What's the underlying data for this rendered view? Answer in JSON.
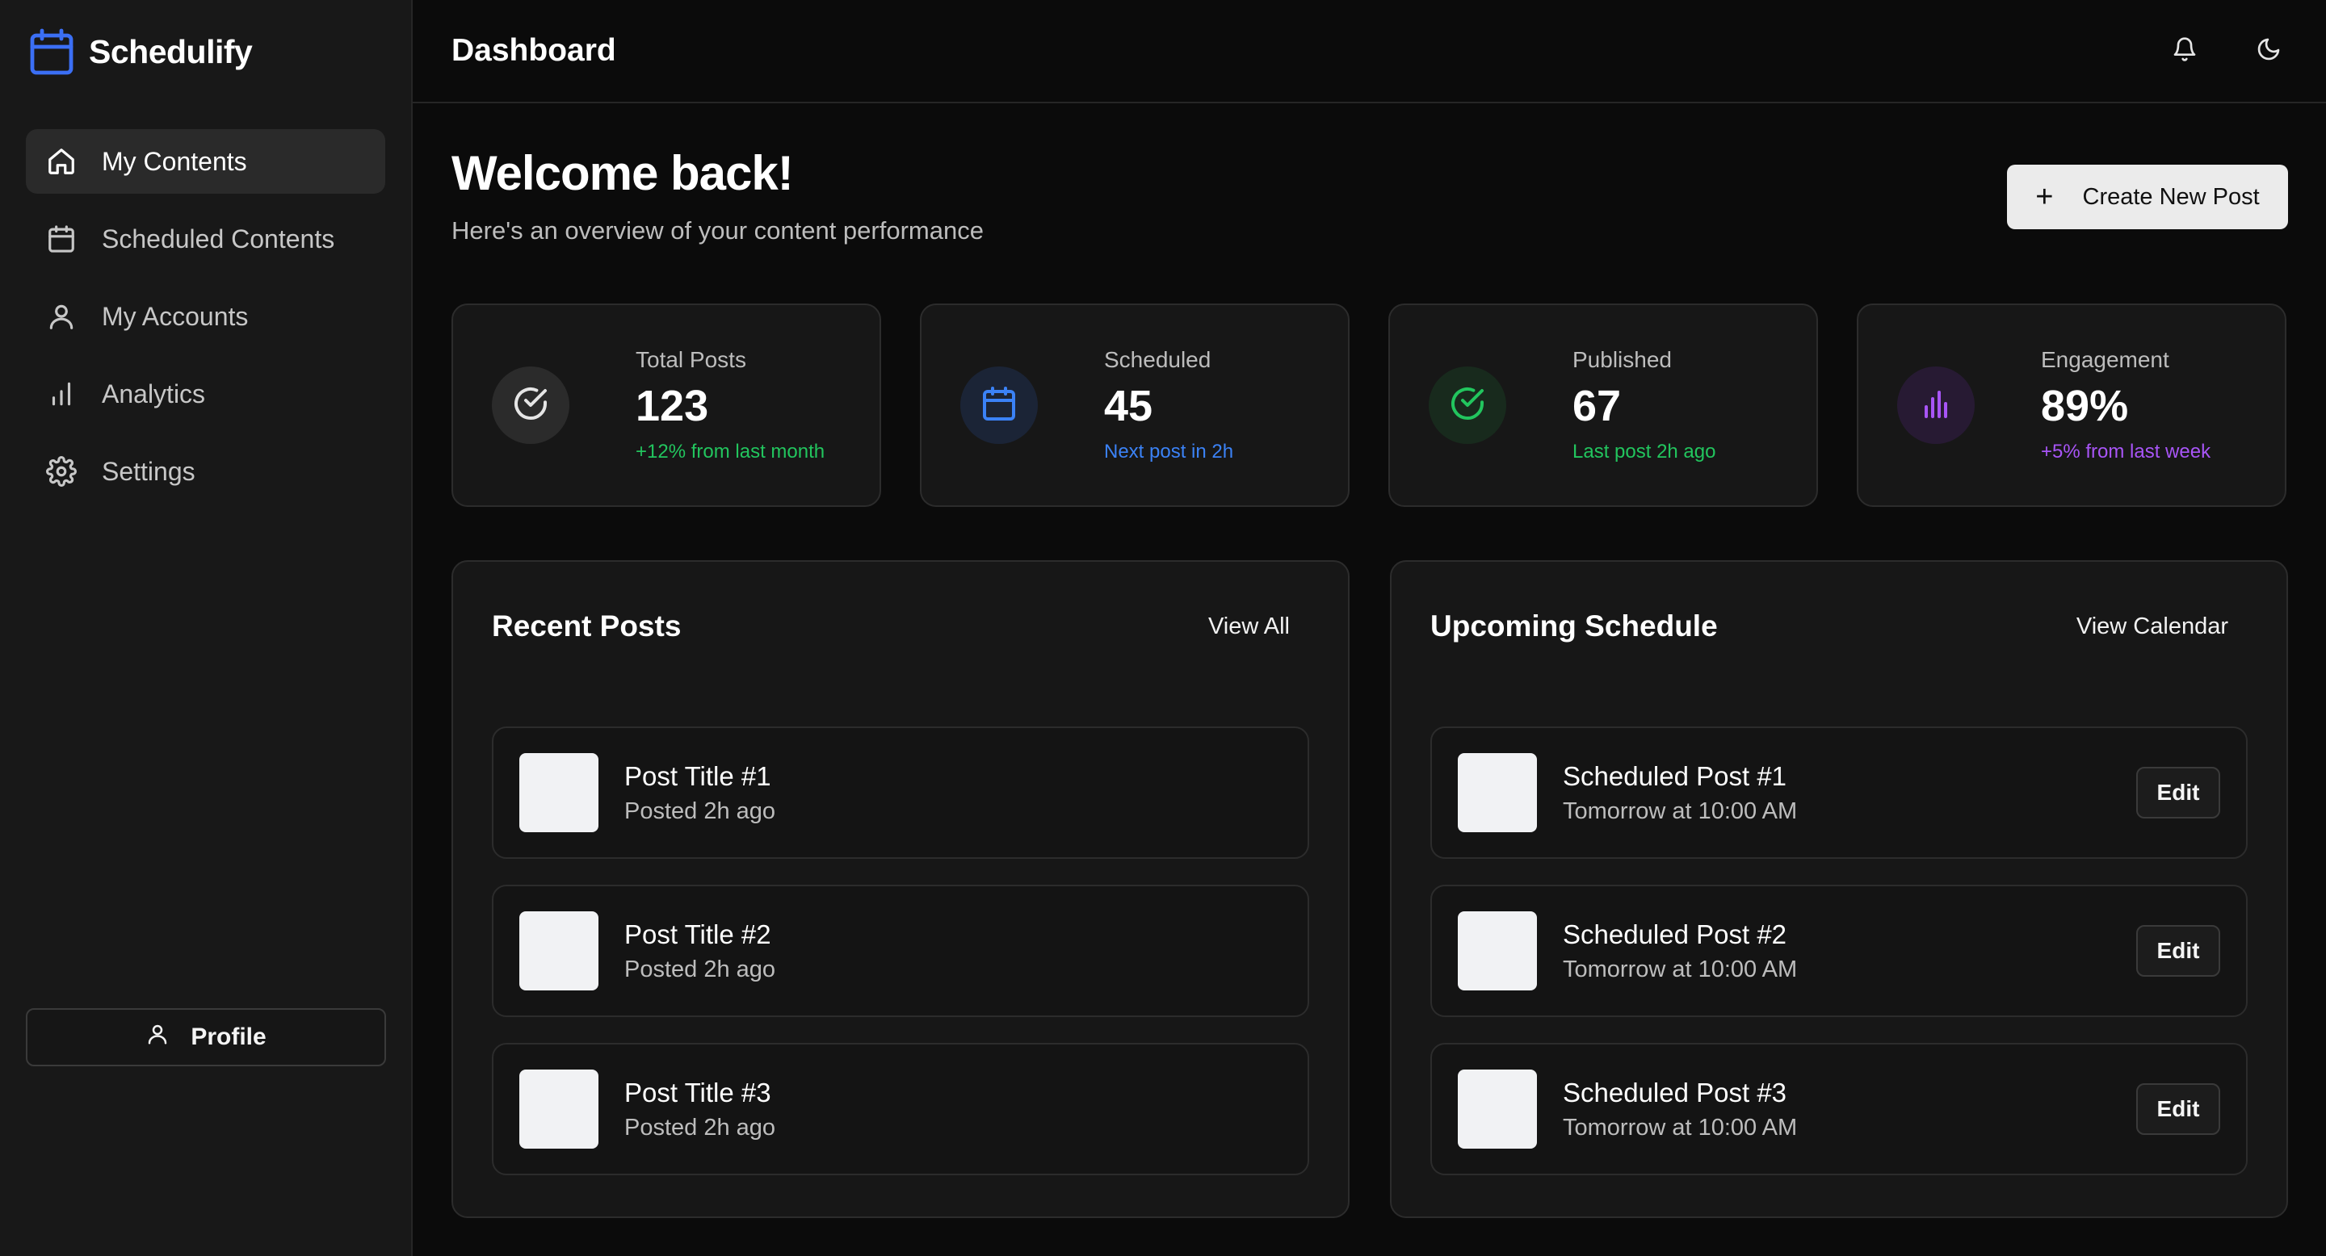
{
  "brand": {
    "name": "Schedulify",
    "icon": "calendar-icon",
    "accent": "#3b6ff5"
  },
  "sidebar": {
    "items": [
      {
        "label": "My Contents",
        "icon": "home-icon",
        "active": true
      },
      {
        "label": "Scheduled Contents",
        "icon": "calendar-icon",
        "active": false
      },
      {
        "label": "My Accounts",
        "icon": "user-icon",
        "active": false
      },
      {
        "label": "Analytics",
        "icon": "bar-chart-icon",
        "active": false
      },
      {
        "label": "Settings",
        "icon": "gear-icon",
        "active": false
      }
    ],
    "profile_label": "Profile"
  },
  "header": {
    "title": "Dashboard",
    "actions": [
      {
        "icon": "bell-icon"
      },
      {
        "icon": "moon-icon"
      }
    ]
  },
  "welcome": {
    "title": "Welcome back!",
    "subtitle": "Here's an overview of your content performance",
    "create_label": "Create New Post"
  },
  "stats": [
    {
      "label": "Total Posts",
      "value": "123",
      "note": "+12% from last month",
      "icon": "check-circle-icon",
      "note_color": "#22c55e",
      "badge_bg": "#2b2b2b",
      "icon_color": "#e5e5e5"
    },
    {
      "label": "Scheduled",
      "value": "45",
      "note": "Next post in 2h",
      "icon": "calendar-icon",
      "note_color": "#3b82f6",
      "badge_bg": "#1b2436",
      "icon_color": "#3b82f6"
    },
    {
      "label": "Published",
      "value": "67",
      "note": "Last post 2h ago",
      "icon": "check-circle-icon",
      "note_color": "#22c55e",
      "badge_bg": "#182a1d",
      "icon_color": "#22c55e"
    },
    {
      "label": "Engagement",
      "value": "89%",
      "note": "+5% from last week",
      "icon": "bar-chart-icon",
      "note_color": "#a855f7",
      "badge_bg": "#271a33",
      "icon_color": "#a855f7"
    }
  ],
  "recent_posts": {
    "title": "Recent Posts",
    "link": "View All",
    "items": [
      {
        "title": "Post Title #1",
        "sub": "Posted 2h ago"
      },
      {
        "title": "Post Title #2",
        "sub": "Posted 2h ago"
      },
      {
        "title": "Post Title #3",
        "sub": "Posted 2h ago"
      }
    ]
  },
  "upcoming": {
    "title": "Upcoming Schedule",
    "link": "View Calendar",
    "edit_label": "Edit",
    "items": [
      {
        "title": "Scheduled Post #1",
        "sub": "Tomorrow at 10:00 AM"
      },
      {
        "title": "Scheduled Post #2",
        "sub": "Tomorrow at 10:00 AM"
      },
      {
        "title": "Scheduled Post #3",
        "sub": "Tomorrow at 10:00 AM"
      }
    ]
  }
}
